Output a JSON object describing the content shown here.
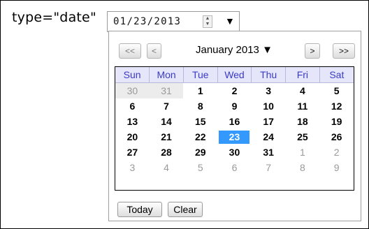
{
  "label": "type=\"date\"",
  "input": {
    "value": "01/23/2013"
  },
  "calendar": {
    "nav": {
      "prev_year": "<<",
      "prev_month": "<",
      "next_month": ">",
      "next_year": ">>"
    },
    "month_label": "January 2013 ▼",
    "weekdays": [
      "Sun",
      "Mon",
      "Tue",
      "Wed",
      "Thu",
      "Fri",
      "Sat"
    ],
    "weeks": [
      [
        "30",
        "31",
        "1",
        "2",
        "3",
        "4",
        "5"
      ],
      [
        "6",
        "7",
        "8",
        "9",
        "10",
        "11",
        "12"
      ],
      [
        "13",
        "14",
        "15",
        "16",
        "17",
        "18",
        "19"
      ],
      [
        "20",
        "21",
        "22",
        "23",
        "24",
        "25",
        "26"
      ],
      [
        "27",
        "28",
        "29",
        "30",
        "31",
        "1",
        "2"
      ],
      [
        "3",
        "4",
        "5",
        "6",
        "7",
        "8",
        "9"
      ]
    ],
    "selected_day": "23",
    "today_label": "Today",
    "clear_label": "Clear"
  },
  "colors": {
    "selected": "#3399ff",
    "header_bg": "#e6e6fa",
    "header_text": "#3a3ac8",
    "other_month_text": "#9a9a9a"
  }
}
